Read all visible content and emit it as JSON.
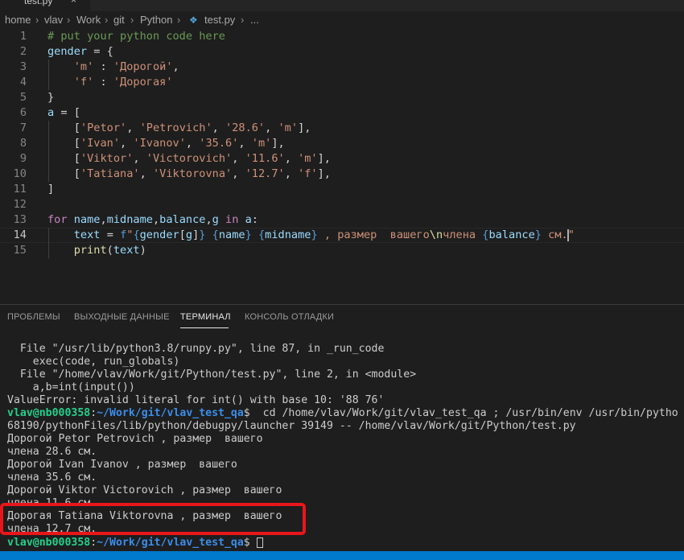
{
  "tabbar": {
    "tab_label": "test.py",
    "close_glyph": "×"
  },
  "breadcrumb": {
    "items": [
      "home",
      "vlav",
      "Work",
      "git",
      "Python",
      "test.py",
      "..."
    ],
    "separator": "›"
  },
  "editor": {
    "line_numbers": [
      "1",
      "2",
      "3",
      "4",
      "5",
      "6",
      "7",
      "8",
      "9",
      "10",
      "11",
      "12",
      "13",
      "14",
      "15"
    ],
    "active_line": 14,
    "lines": [
      "# put your python code here",
      "gender = {",
      "    'm' : 'Дорогой',",
      "    'f' : 'Дорогая'",
      "}",
      "a = [",
      "    ['Petor', 'Petrovich', '28.6', 'm'],",
      "    ['Ivan', 'Ivanov', '35.6', 'm'],",
      "    ['Viktor', 'Victorovich', '11.6', 'm'],",
      "    ['Tatiana', 'Viktorovna', '12.7', 'f'],",
      "]",
      "",
      "for name,midname,balance,g in a:",
      "    text = f\"{gender[g]} {name} {midname} , размер  вашего\\nчлена {balance} см.\"",
      "    print(text)"
    ]
  },
  "panel": {
    "tabs": [
      {
        "label": "ПРОБЛЕМЫ",
        "active": false
      },
      {
        "label": "ВЫХОДНЫЕ ДАННЫЕ",
        "active": false
      },
      {
        "label": "ТЕРМИНАЛ",
        "active": true
      },
      {
        "label": "КОНСОЛЬ ОТЛАДКИ",
        "active": false
      }
    ]
  },
  "terminal": {
    "lines": [
      "  File \"/usr/lib/python3.8/runpy.py\", line 87, in _run_code",
      "    exec(code, run_globals)",
      "  File \"/home/vlav/Work/git/Python/test.py\", line 2, in <module>",
      "    a,b=int(input())",
      "ValueError: invalid literal for int() with base 10: '88 76'"
    ],
    "prompt_user": "vlav@nb000358",
    "prompt_sep": ":",
    "prompt_path": "~/Work/git/vlav_test_qa",
    "prompt_dollar": "$",
    "command": "  cd /home/vlav/Work/git/vlav_test_qa ; /usr/bin/env /usr/bin/pytho",
    "command_cont": "68190/pythonFiles/lib/python/debugpy/launcher 39149 -- /home/vlav/Work/git/Python/test.py",
    "output": [
      "Дорогой Petor Petrovich , размер  вашего",
      "члена 28.6 см.",
      "Дорогой Ivan Ivanov , размер  вашего",
      "члена 35.6 см.",
      "Дорогой Viktor Victorovich , размер  вашего",
      "члена 11.6 см.",
      "Дорогая Tatiana Viktorovna , размер  вашего",
      "члена 12.7 см."
    ],
    "colors": {
      "user": "#23d18b",
      "path": "#3b8eea",
      "highlight_box": "#e8161b"
    }
  }
}
